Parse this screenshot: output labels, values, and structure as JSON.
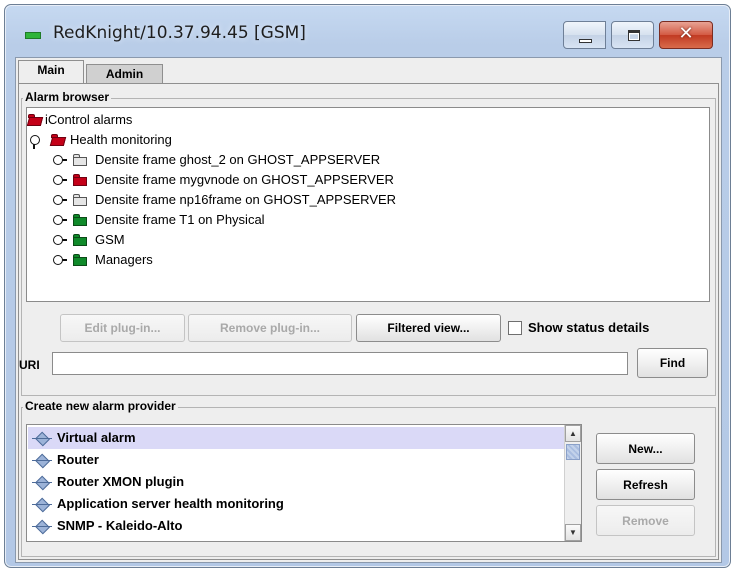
{
  "window": {
    "title": "RedKnight/10.37.94.45 [GSM]",
    "controls": {
      "minimize": "minimize",
      "maximize": "maximize",
      "close": "✕"
    }
  },
  "tabs": [
    {
      "label": "Main",
      "active": true
    },
    {
      "label": "Admin",
      "active": false
    }
  ],
  "alarm_browser": {
    "title": "Alarm browser",
    "tree": [
      {
        "label": "iControl alarms",
        "folder_color": "red",
        "expanded": true
      },
      {
        "label": "Health monitoring",
        "folder_color": "red",
        "expanded": true
      },
      {
        "label": "Densite frame ghost_2 on GHOST_APPSERVER",
        "folder_color": "gray",
        "expanded": false
      },
      {
        "label": "Densite frame mygvnode on GHOST_APPSERVER",
        "folder_color": "red",
        "expanded": false
      },
      {
        "label": "Densite frame np16frame on GHOST_APPSERVER",
        "folder_color": "gray",
        "expanded": false
      },
      {
        "label": "Densite frame T1 on Physical",
        "folder_color": "green",
        "expanded": false
      },
      {
        "label": "GSM",
        "folder_color": "green",
        "expanded": false
      },
      {
        "label": "Managers",
        "folder_color": "green",
        "expanded": false
      }
    ],
    "buttons": {
      "edit_plugin": "Edit plug-in...",
      "remove_plugin": "Remove plug-in...",
      "filtered_view": "Filtered view..."
    },
    "show_status_details": {
      "label": "Show status details",
      "checked": false
    },
    "uri": {
      "label": "URI",
      "value": ""
    },
    "find": "Find"
  },
  "provider": {
    "title": "Create new alarm provider",
    "items": [
      {
        "label": "Virtual alarm",
        "selected": true
      },
      {
        "label": "Router",
        "selected": false
      },
      {
        "label": "Router XMON plugin",
        "selected": false
      },
      {
        "label": "Application server health monitoring",
        "selected": false
      },
      {
        "label": "SNMP - Kaleido-Alto",
        "selected": false
      }
    ],
    "buttons": {
      "new": "New...",
      "refresh": "Refresh",
      "remove": "Remove"
    }
  },
  "colors": {
    "folder_red": "#c40018",
    "folder_green": "#0f8a2a",
    "selection": "#dad9f7",
    "close_button": "#c13a22"
  }
}
